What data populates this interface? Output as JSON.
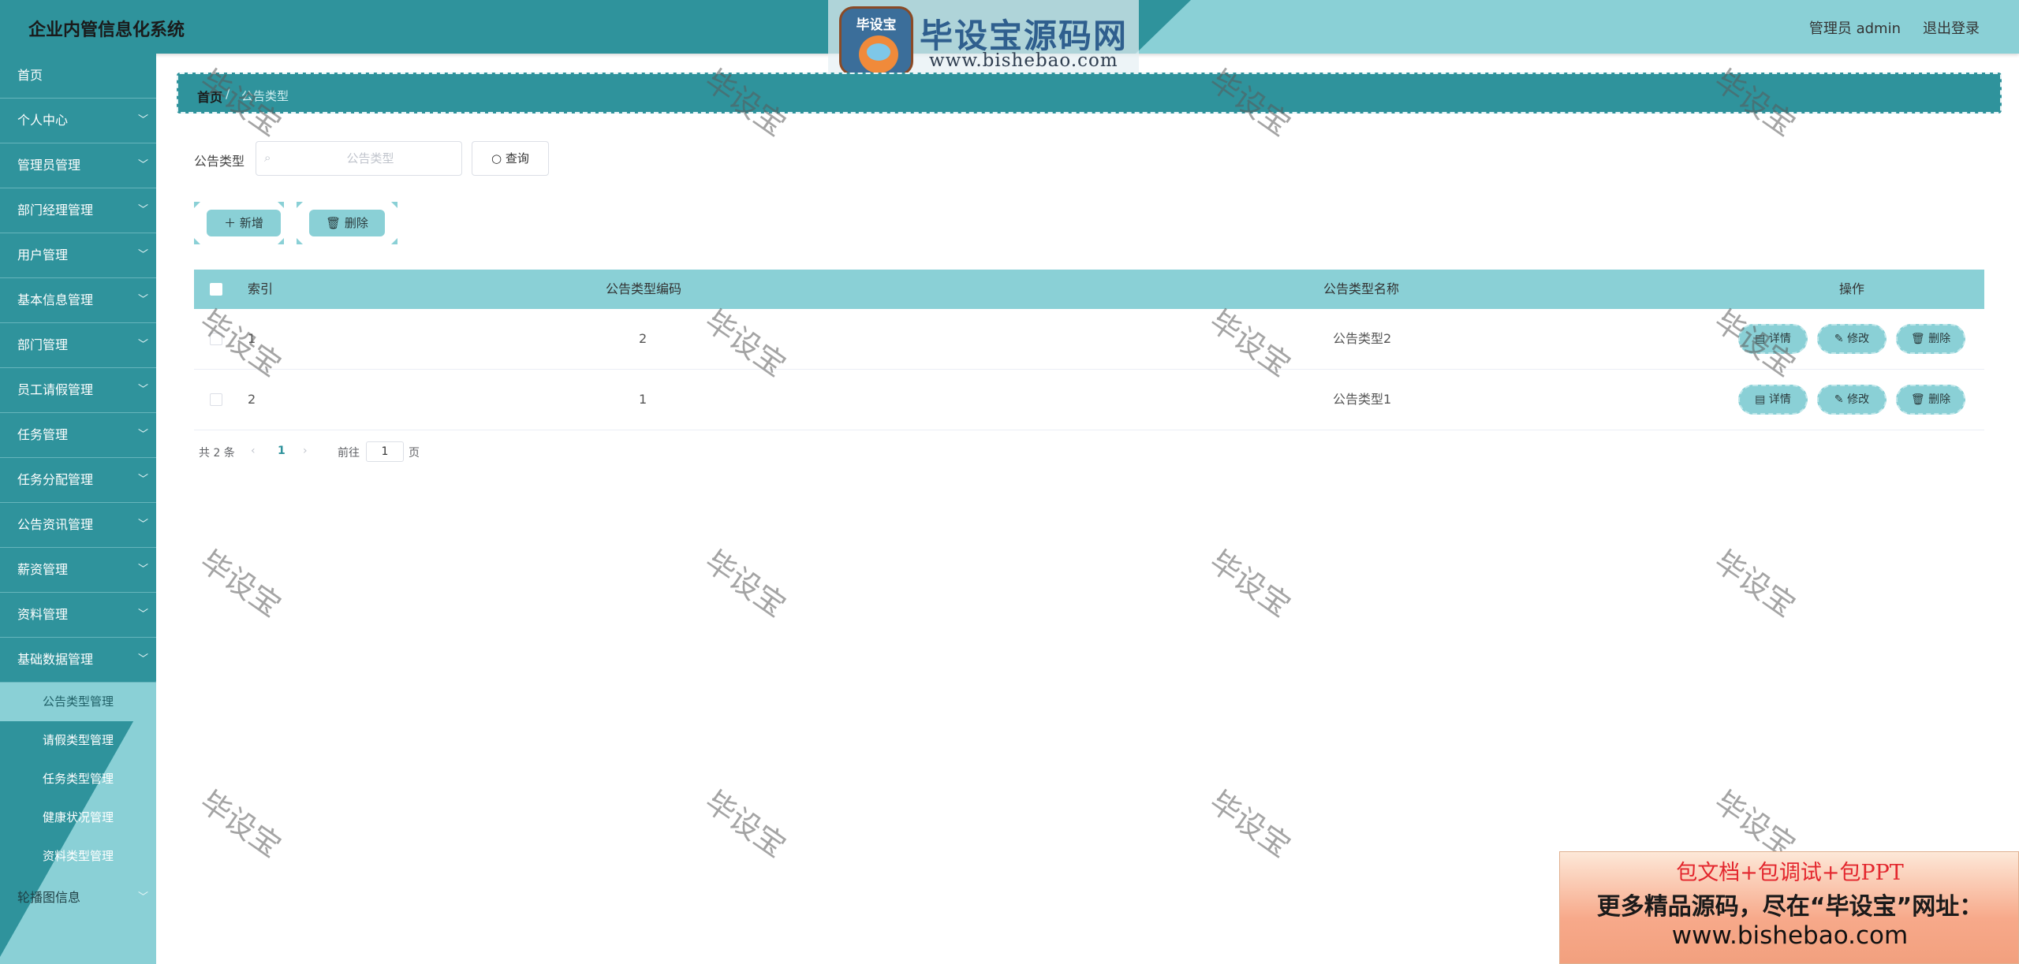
{
  "header": {
    "title": "企业内管信息化系统",
    "user": "管理员 admin",
    "logout": "退出登录"
  },
  "logo": {
    "mascot_text": "毕设宝",
    "name": "毕设宝源码网",
    "url": "www.bishebao.com"
  },
  "sidebar": {
    "items": [
      {
        "label": "首页",
        "expandable": false
      },
      {
        "label": "个人中心",
        "expandable": true
      },
      {
        "label": "管理员管理",
        "expandable": true
      },
      {
        "label": "部门经理管理",
        "expandable": true
      },
      {
        "label": "用户管理",
        "expandable": true
      },
      {
        "label": "基本信息管理",
        "expandable": true
      },
      {
        "label": "部门管理",
        "expandable": true
      },
      {
        "label": "员工请假管理",
        "expandable": true
      },
      {
        "label": "任务管理",
        "expandable": true
      },
      {
        "label": "任务分配管理",
        "expandable": true
      },
      {
        "label": "公告资讯管理",
        "expandable": true
      },
      {
        "label": "薪资管理",
        "expandable": true
      },
      {
        "label": "资料管理",
        "expandable": true
      },
      {
        "label": "基础数据管理",
        "expandable": true
      }
    ],
    "submenu": [
      {
        "label": "公告类型管理",
        "active": true
      },
      {
        "label": "请假类型管理",
        "active": false
      },
      {
        "label": "任务类型管理",
        "active": false
      },
      {
        "label": "健康状况管理",
        "active": false
      },
      {
        "label": "资料类型管理",
        "active": false
      }
    ],
    "last_item": {
      "label": "轮播图信息",
      "expandable": true
    },
    "chevron": "chevron-down-icon"
  },
  "breadcrumb": {
    "home": "首页",
    "separator": "/",
    "current": "公告类型"
  },
  "search": {
    "label": "公告类型",
    "placeholder": "公告类型",
    "value": "",
    "button": "查询"
  },
  "actions": {
    "add": "新增",
    "delete": "删除"
  },
  "table": {
    "columns": [
      "索引",
      "公告类型编码",
      "公告类型名称",
      "操作"
    ],
    "rows": [
      {
        "index": "1",
        "code": "2",
        "name": "公告类型2"
      },
      {
        "index": "2",
        "code": "1",
        "name": "公告类型1"
      }
    ],
    "row_actions": {
      "detail": "详情",
      "edit": "修改",
      "delete": "删除"
    }
  },
  "pagination": {
    "total": "共 2 条",
    "prev": "‹",
    "current_page": "1",
    "next": "›",
    "goto": "前往",
    "goto_value": "1",
    "page_unit": "页"
  },
  "watermark": "毕设宝",
  "promo": {
    "line1": "包文档+包调试+包PPT",
    "line2": "更多精品源码，尽在“毕设宝”网址：",
    "line3": "www.bishebao.com"
  },
  "colors": {
    "primary_dark": "#2f939c",
    "primary_light": "#8ad0d6"
  }
}
